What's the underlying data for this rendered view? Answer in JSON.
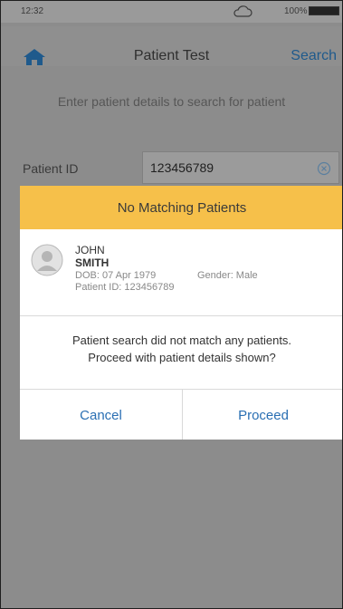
{
  "status_bar": {
    "time": "12:32",
    "battery": "100%"
  },
  "nav": {
    "title": "Patient Test",
    "search_label": "Search"
  },
  "form": {
    "instructions": "Enter patient details to search for patient",
    "patient_id_label": "Patient ID",
    "patient_id_value": "123456789"
  },
  "modal": {
    "title": "No Matching Patients",
    "patient": {
      "first_name": "JOHN",
      "last_name": "SMITH",
      "dob": "DOB: 07 Apr 1979",
      "gender": "Gender: Male",
      "patient_id": "Patient ID: 123456789"
    },
    "message_line1": "Patient search did not match any patients.",
    "message_line2": "Proceed with patient details shown?",
    "cancel_label": "Cancel",
    "proceed_label": "Proceed"
  },
  "colors": {
    "accent": "#2a6fb3",
    "header": "#f6c04a",
    "dim_overlay": "#8c8c8c"
  }
}
